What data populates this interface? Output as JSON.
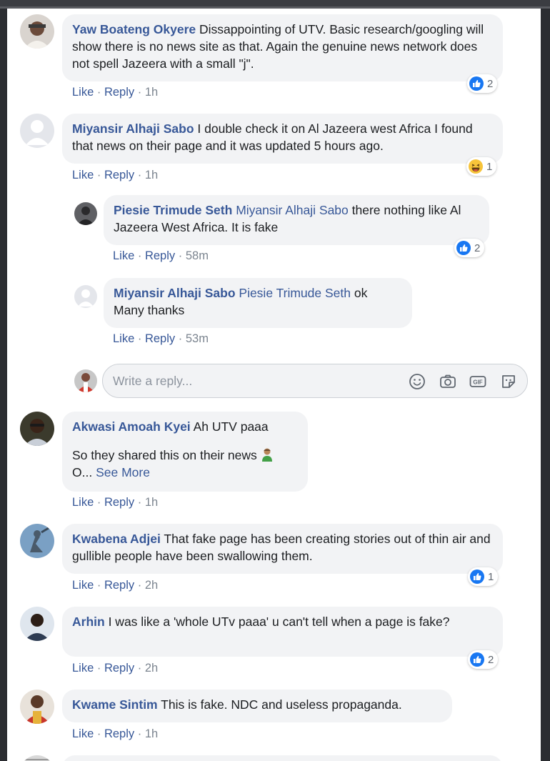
{
  "comments": [
    {
      "author": "Yaw Boateng Okyere",
      "text": "Dissappointing of UTV. Basic research/googling will show there is no news site as that. Again the genuine news network does not spell Jazeera with a small \"j\".",
      "like": "Like",
      "reply": "Reply",
      "time": "1h",
      "reaction_icon": "like-icon",
      "reaction_count": "2"
    },
    {
      "author": "Miyansir Alhaji Sabo",
      "text": "I double check it on Al Jazeera west Africa I found that news on their page and it was updated 5 hours ago.",
      "like": "Like",
      "reply": "Reply",
      "time": "1h",
      "reaction_icon": "haha-icon",
      "reaction_count": "1",
      "replies": [
        {
          "author": "Piesie Trimude Seth",
          "mention": "Miyansir Alhaji Sabo",
          "text": "there nothing like Al Jazeera West Africa. It is fake",
          "like": "Like",
          "reply": "Reply",
          "time": "58m",
          "reaction_icon": "like-icon",
          "reaction_count": "2"
        },
        {
          "author": "Miyansir Alhaji Sabo",
          "mention": "Piesie Trimude Seth",
          "text_line1": "ok",
          "text_line2": "Many thanks",
          "like": "Like",
          "reply": "Reply",
          "time": "53m"
        }
      ]
    },
    {
      "author": "Akwasi Amoah Kyei",
      "text": "Ah UTV paaa",
      "text_line2": "So they shared this on their news",
      "text_line3": "O...",
      "see_more": "See More",
      "like": "Like",
      "reply": "Reply",
      "time": "1h"
    },
    {
      "author": "Kwabena Adjei",
      "text": "That fake page has been creating stories out of thin air and gullible people have been swallowing them.",
      "like": "Like",
      "reply": "Reply",
      "time": "2h",
      "reaction_icon": "like-icon",
      "reaction_count": "1"
    },
    {
      "author": "Arhin",
      "text": "I was like a 'whole UTv paaa' u can't tell when a page is fake?",
      "like": "Like",
      "reply": "Reply",
      "time": "2h",
      "reaction_icon": "like-icon",
      "reaction_count": "2"
    },
    {
      "author": "Kwame Sintim",
      "text": "This is fake. NDC and useless propaganda.",
      "like": "Like",
      "reply": "Reply",
      "time": "1h"
    }
  ],
  "reply_box": {
    "placeholder": "Write a reply...",
    "icons": [
      "emoji-icon",
      "camera-icon",
      "gif-icon",
      "sticker-icon"
    ]
  },
  "separator": "·",
  "colors": {
    "link": "#385898",
    "bubble": "#f2f3f5",
    "like_blue": "#1877f2",
    "meta_gray": "#7c8590"
  }
}
